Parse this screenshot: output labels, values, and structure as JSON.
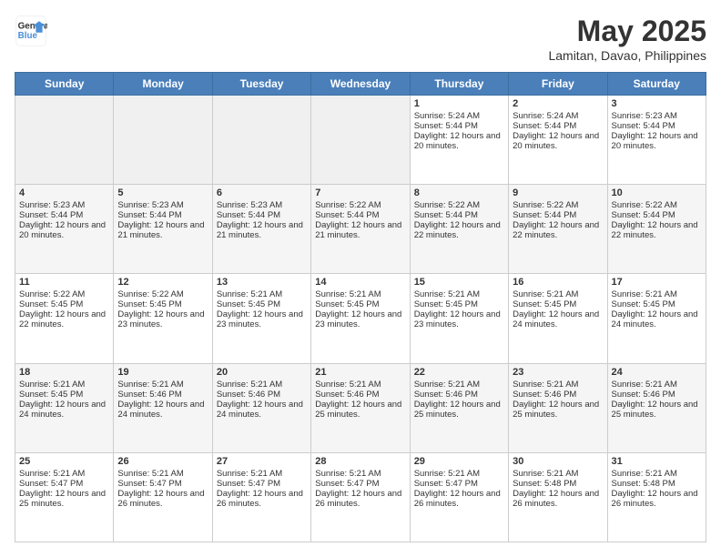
{
  "header": {
    "logo_line1": "General",
    "logo_line2": "Blue",
    "month": "May 2025",
    "location": "Lamitan, Davao, Philippines"
  },
  "weekdays": [
    "Sunday",
    "Monday",
    "Tuesday",
    "Wednesday",
    "Thursday",
    "Friday",
    "Saturday"
  ],
  "weeks": [
    [
      {
        "day": "",
        "empty": true
      },
      {
        "day": "",
        "empty": true
      },
      {
        "day": "",
        "empty": true
      },
      {
        "day": "",
        "empty": true
      },
      {
        "day": "1",
        "sunrise": "5:24 AM",
        "sunset": "5:44 PM",
        "daylight": "12 hours and 20 minutes."
      },
      {
        "day": "2",
        "sunrise": "5:24 AM",
        "sunset": "5:44 PM",
        "daylight": "12 hours and 20 minutes."
      },
      {
        "day": "3",
        "sunrise": "5:23 AM",
        "sunset": "5:44 PM",
        "daylight": "12 hours and 20 minutes."
      }
    ],
    [
      {
        "day": "4",
        "sunrise": "5:23 AM",
        "sunset": "5:44 PM",
        "daylight": "12 hours and 20 minutes."
      },
      {
        "day": "5",
        "sunrise": "5:23 AM",
        "sunset": "5:44 PM",
        "daylight": "12 hours and 21 minutes."
      },
      {
        "day": "6",
        "sunrise": "5:23 AM",
        "sunset": "5:44 PM",
        "daylight": "12 hours and 21 minutes."
      },
      {
        "day": "7",
        "sunrise": "5:22 AM",
        "sunset": "5:44 PM",
        "daylight": "12 hours and 21 minutes."
      },
      {
        "day": "8",
        "sunrise": "5:22 AM",
        "sunset": "5:44 PM",
        "daylight": "12 hours and 22 minutes."
      },
      {
        "day": "9",
        "sunrise": "5:22 AM",
        "sunset": "5:44 PM",
        "daylight": "12 hours and 22 minutes."
      },
      {
        "day": "10",
        "sunrise": "5:22 AM",
        "sunset": "5:44 PM",
        "daylight": "12 hours and 22 minutes."
      }
    ],
    [
      {
        "day": "11",
        "sunrise": "5:22 AM",
        "sunset": "5:45 PM",
        "daylight": "12 hours and 22 minutes."
      },
      {
        "day": "12",
        "sunrise": "5:22 AM",
        "sunset": "5:45 PM",
        "daylight": "12 hours and 23 minutes."
      },
      {
        "day": "13",
        "sunrise": "5:21 AM",
        "sunset": "5:45 PM",
        "daylight": "12 hours and 23 minutes."
      },
      {
        "day": "14",
        "sunrise": "5:21 AM",
        "sunset": "5:45 PM",
        "daylight": "12 hours and 23 minutes."
      },
      {
        "day": "15",
        "sunrise": "5:21 AM",
        "sunset": "5:45 PM",
        "daylight": "12 hours and 23 minutes."
      },
      {
        "day": "16",
        "sunrise": "5:21 AM",
        "sunset": "5:45 PM",
        "daylight": "12 hours and 24 minutes."
      },
      {
        "day": "17",
        "sunrise": "5:21 AM",
        "sunset": "5:45 PM",
        "daylight": "12 hours and 24 minutes."
      }
    ],
    [
      {
        "day": "18",
        "sunrise": "5:21 AM",
        "sunset": "5:45 PM",
        "daylight": "12 hours and 24 minutes."
      },
      {
        "day": "19",
        "sunrise": "5:21 AM",
        "sunset": "5:46 PM",
        "daylight": "12 hours and 24 minutes."
      },
      {
        "day": "20",
        "sunrise": "5:21 AM",
        "sunset": "5:46 PM",
        "daylight": "12 hours and 24 minutes."
      },
      {
        "day": "21",
        "sunrise": "5:21 AM",
        "sunset": "5:46 PM",
        "daylight": "12 hours and 25 minutes."
      },
      {
        "day": "22",
        "sunrise": "5:21 AM",
        "sunset": "5:46 PM",
        "daylight": "12 hours and 25 minutes."
      },
      {
        "day": "23",
        "sunrise": "5:21 AM",
        "sunset": "5:46 PM",
        "daylight": "12 hours and 25 minutes."
      },
      {
        "day": "24",
        "sunrise": "5:21 AM",
        "sunset": "5:46 PM",
        "daylight": "12 hours and 25 minutes."
      }
    ],
    [
      {
        "day": "25",
        "sunrise": "5:21 AM",
        "sunset": "5:47 PM",
        "daylight": "12 hours and 25 minutes."
      },
      {
        "day": "26",
        "sunrise": "5:21 AM",
        "sunset": "5:47 PM",
        "daylight": "12 hours and 26 minutes."
      },
      {
        "day": "27",
        "sunrise": "5:21 AM",
        "sunset": "5:47 PM",
        "daylight": "12 hours and 26 minutes."
      },
      {
        "day": "28",
        "sunrise": "5:21 AM",
        "sunset": "5:47 PM",
        "daylight": "12 hours and 26 minutes."
      },
      {
        "day": "29",
        "sunrise": "5:21 AM",
        "sunset": "5:47 PM",
        "daylight": "12 hours and 26 minutes."
      },
      {
        "day": "30",
        "sunrise": "5:21 AM",
        "sunset": "5:48 PM",
        "daylight": "12 hours and 26 minutes."
      },
      {
        "day": "31",
        "sunrise": "5:21 AM",
        "sunset": "5:48 PM",
        "daylight": "12 hours and 26 minutes."
      }
    ]
  ]
}
